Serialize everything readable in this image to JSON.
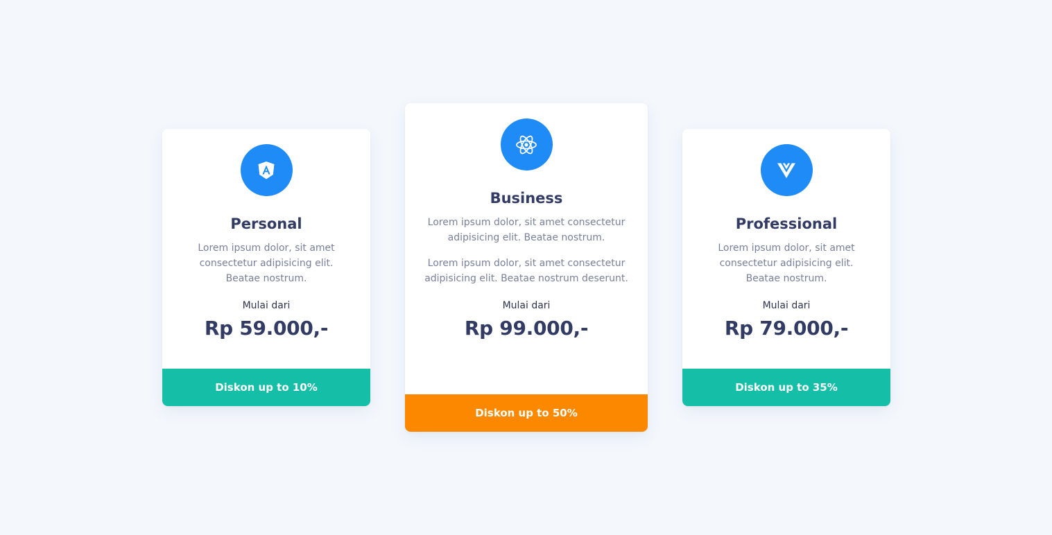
{
  "colors": {
    "background": "#f4f8fd",
    "icon_circle": "#1f8bf6",
    "title_text": "#323b63",
    "body_text": "#79809a",
    "teal_bar": "#14bea7",
    "orange_bar": "#fc8800"
  },
  "plans": [
    {
      "icon": "angular-icon",
      "title": "Personal",
      "descriptions": [
        "Lorem ipsum dolor, sit amet consectetur adipisicing elit. Beatae nostrum."
      ],
      "price_label": "Mulai dari",
      "price": "Rp 59.000,-",
      "discount": "Diskon up to 10%",
      "discount_color": "#14bea7"
    },
    {
      "icon": "react-icon",
      "title": "Business",
      "descriptions": [
        "Lorem ipsum dolor, sit amet consectetur adipisicing elit. Beatae nostrum.",
        "Lorem ipsum dolor, sit amet consectetur adipisicing elit. Beatae nostrum deserunt."
      ],
      "price_label": "Mulai dari",
      "price": "Rp 99.000,-",
      "discount": "Diskon up to 50%",
      "discount_color": "#fc8800"
    },
    {
      "icon": "vue-icon",
      "title": "Professional",
      "descriptions": [
        "Lorem ipsum dolor, sit amet consectetur adipisicing elit. Beatae nostrum."
      ],
      "price_label": "Mulai dari",
      "price": "Rp 79.000,-",
      "discount": "Diskon up to 35%",
      "discount_color": "#14bea7"
    }
  ]
}
